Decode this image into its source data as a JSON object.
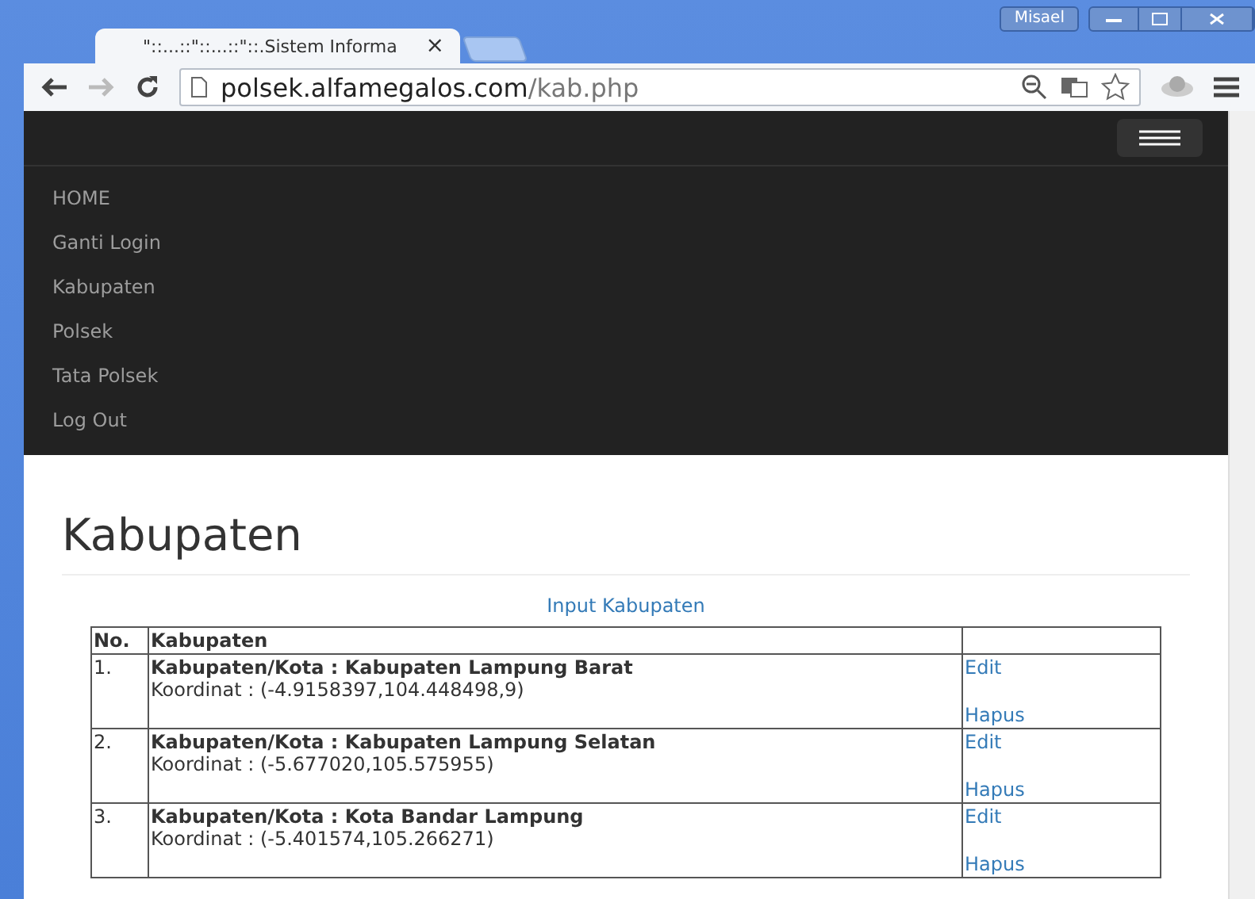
{
  "browser": {
    "tab_title": "\"::...::\"::...::\"::.Sistem Informa",
    "tab_close": "×",
    "user": "Misael",
    "url_host": "polsek.alfamegalos.com",
    "url_path": "/kab.php"
  },
  "navbar": {
    "items": [
      {
        "label": "HOME"
      },
      {
        "label": "Ganti Login"
      },
      {
        "label": "Kabupaten"
      },
      {
        "label": "Polsek"
      },
      {
        "label": "Tata Polsek"
      },
      {
        "label": "Log Out"
      }
    ]
  },
  "page": {
    "title": "Kabupaten",
    "input_link": "Input Kabupaten"
  },
  "table": {
    "columns": [
      "No.",
      "Kabupaten"
    ],
    "rows": [
      {
        "no": "1.",
        "name": "Kabupaten/Kota : Kabupaten Lampung Barat",
        "coords": "Koordinat : (-4.9158397,104.448498,9)",
        "edit": "Edit",
        "delete": "Hapus"
      },
      {
        "no": "2.",
        "name": "Kabupaten/Kota : Kabupaten Lampung Selatan",
        "coords": "Koordinat : (-5.677020,105.575955)",
        "edit": "Edit",
        "delete": "Hapus"
      },
      {
        "no": "3.",
        "name": "Kabupaten/Kota : Kota Bandar Lampung",
        "coords": "Koordinat : (-5.401574,105.266271)",
        "edit": "Edit",
        "delete": "Hapus"
      }
    ]
  }
}
